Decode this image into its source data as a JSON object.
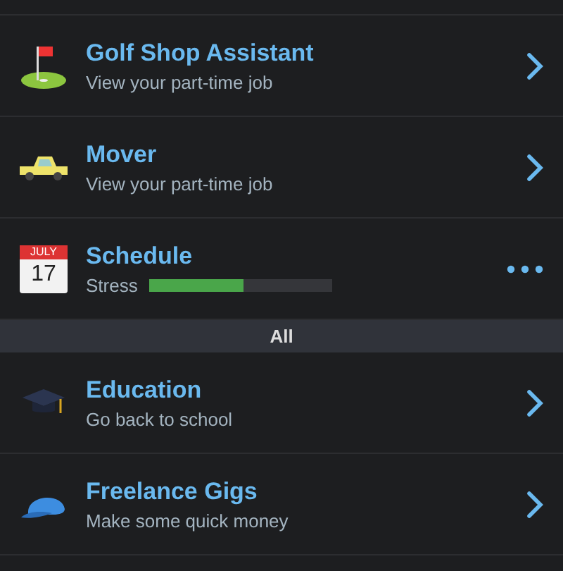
{
  "sections": [
    {
      "rows": [
        {
          "kind": "link",
          "title": "Golf Shop Assistant",
          "subtitle": "View your part-time job"
        },
        {
          "kind": "link",
          "title": "Mover",
          "subtitle": "View your part-time job"
        },
        {
          "kind": "meter",
          "title": "Schedule",
          "calendar": {
            "month": "JULY",
            "day": "17"
          },
          "meter_label": "Stress",
          "level": 0.52
        }
      ]
    },
    {
      "header": "All",
      "rows": [
        {
          "kind": "link",
          "title": "Education",
          "subtitle": "Go back to school"
        },
        {
          "kind": "link",
          "title": "Freelance Gigs",
          "subtitle": "Make some quick money"
        }
      ]
    }
  ]
}
